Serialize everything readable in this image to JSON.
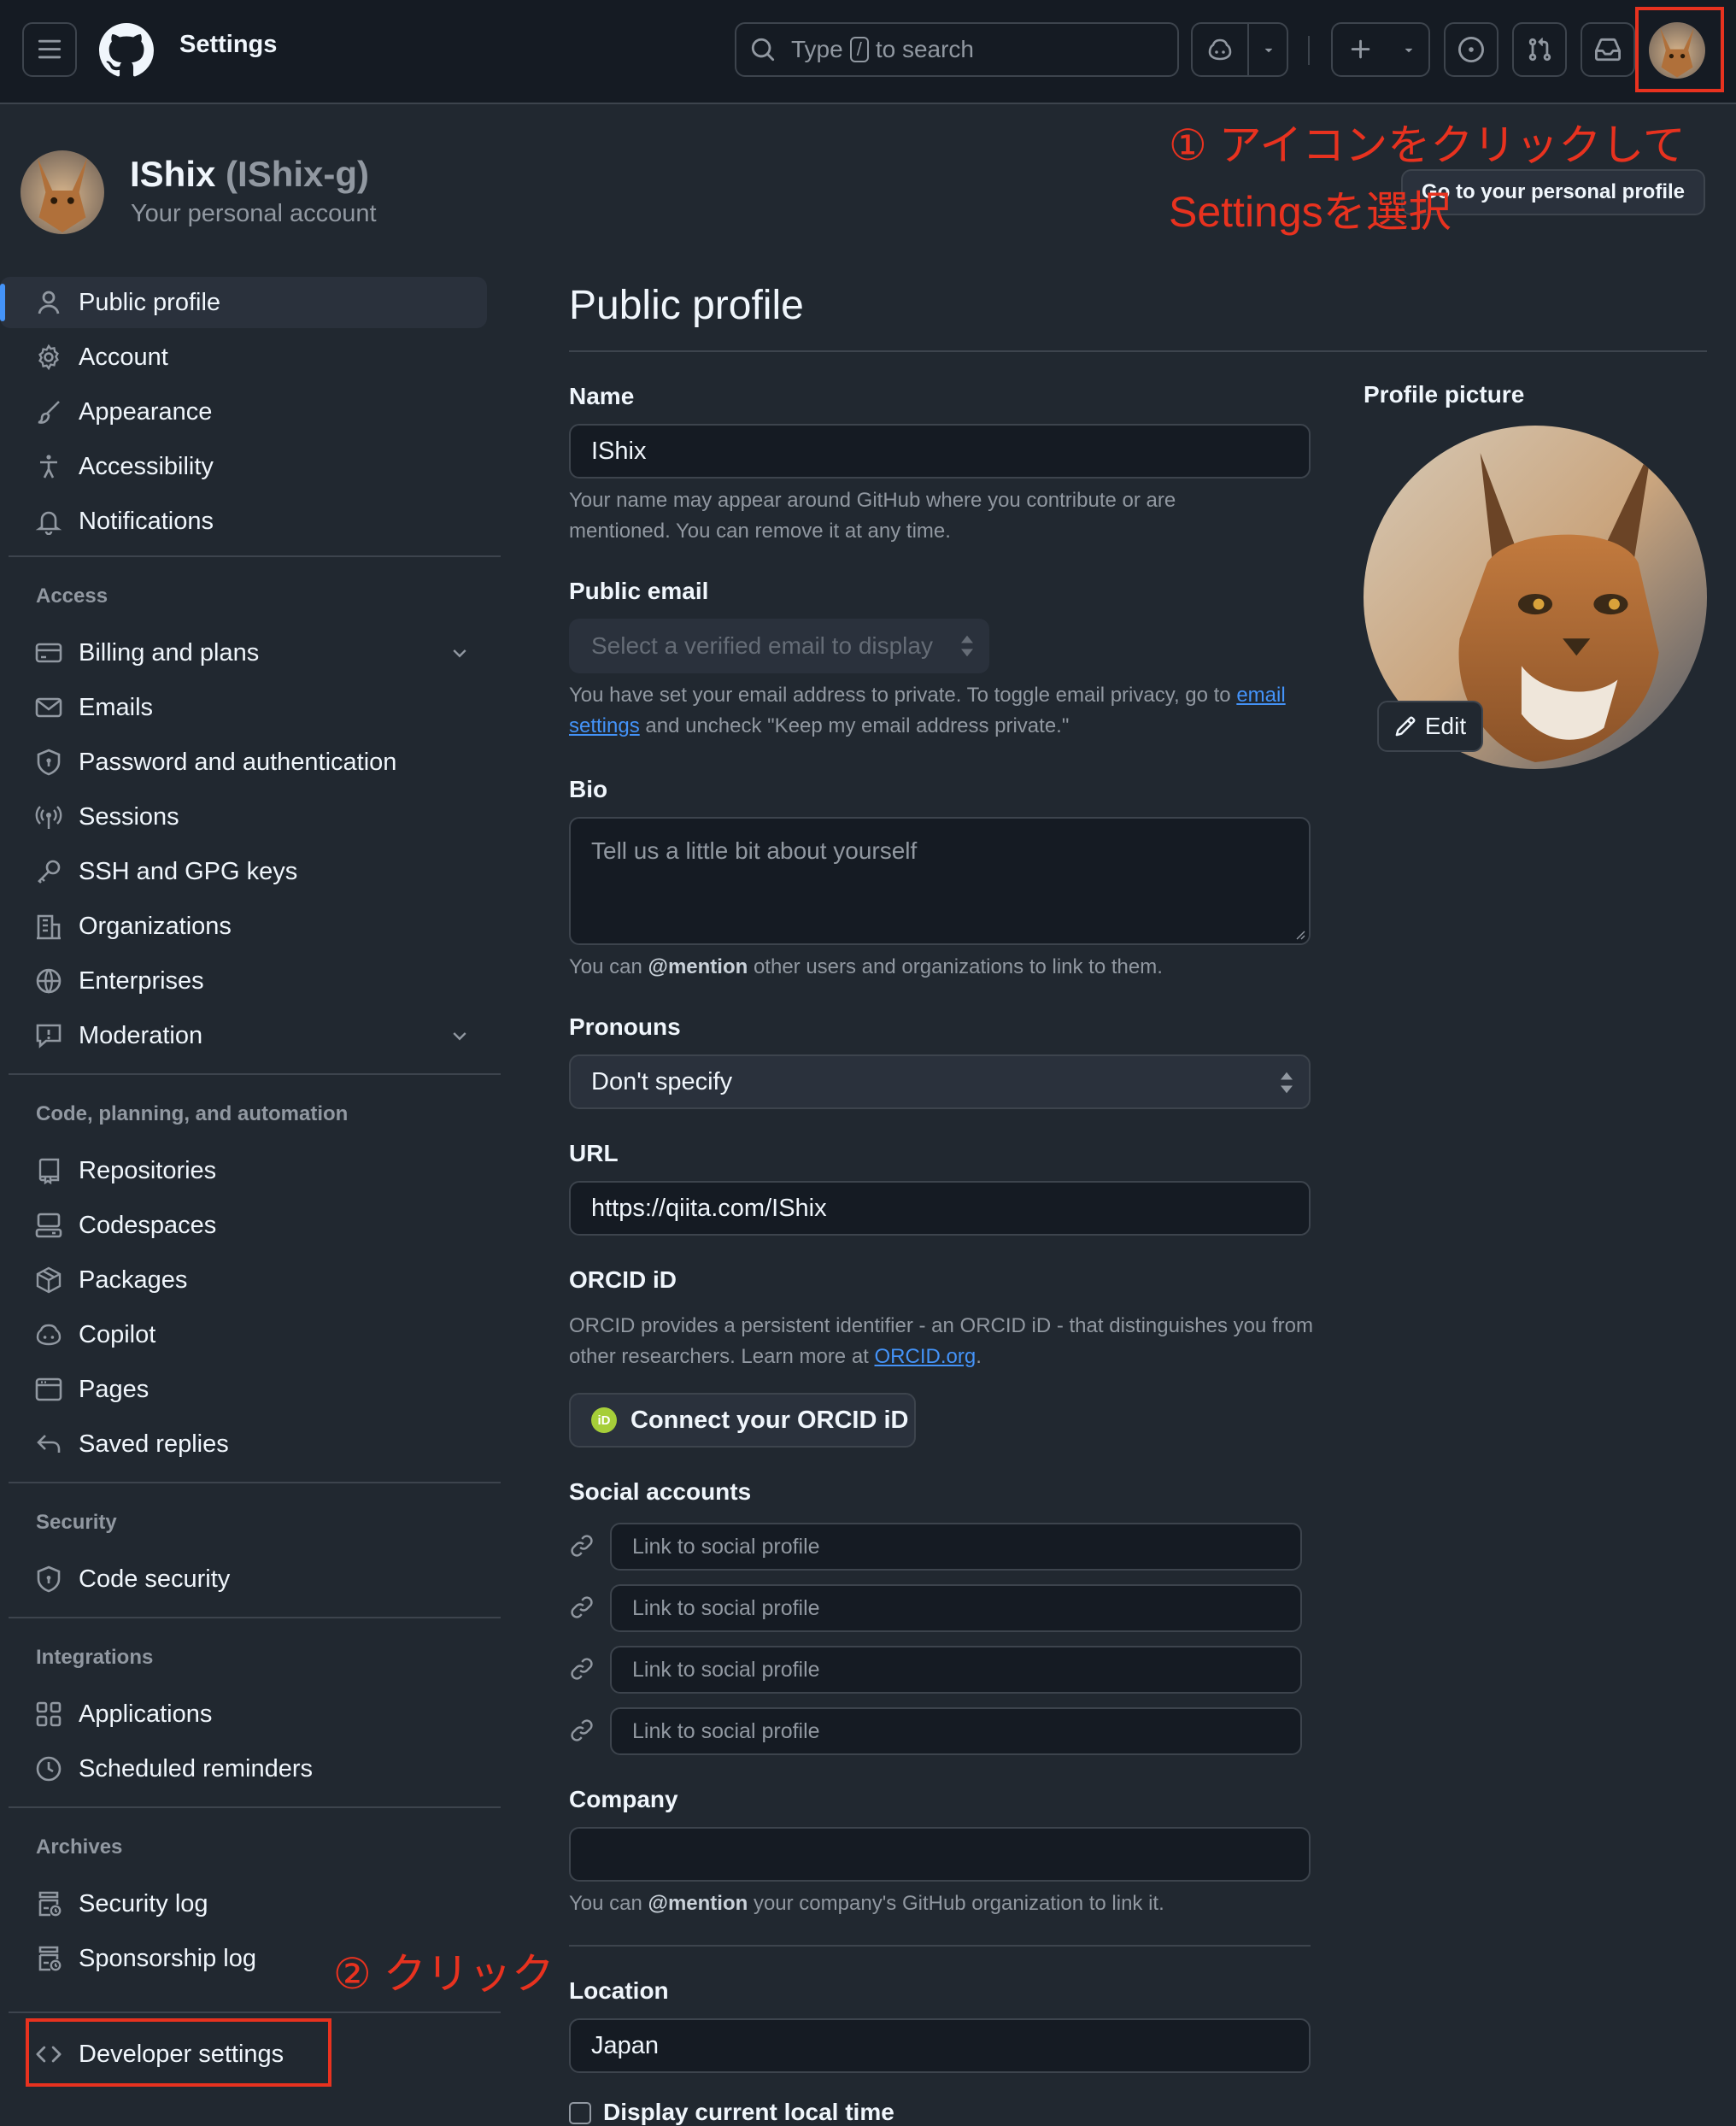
{
  "header": {
    "title": "Settings",
    "search_pre": "Type",
    "search_key": "/",
    "search_post": "to search"
  },
  "account": {
    "display_name": "IShix",
    "handle": "(IShix-g)",
    "subtitle": "Your personal account",
    "profile_button": "Go to your personal profile"
  },
  "sidebar": {
    "top_items": [
      {
        "label": "Public profile",
        "icon": "person-icon"
      },
      {
        "label": "Account",
        "icon": "gear-icon"
      },
      {
        "label": "Appearance",
        "icon": "paintbrush-icon"
      },
      {
        "label": "Accessibility",
        "icon": "accessibility-icon"
      },
      {
        "label": "Notifications",
        "icon": "bell-icon"
      }
    ],
    "sections": [
      {
        "heading": "Access",
        "items": [
          {
            "label": "Billing and plans",
            "icon": "credit-card-icon",
            "expandable": true
          },
          {
            "label": "Emails",
            "icon": "mail-icon"
          },
          {
            "label": "Password and authentication",
            "icon": "shield-lock-icon"
          },
          {
            "label": "Sessions",
            "icon": "broadcast-icon"
          },
          {
            "label": "SSH and GPG keys",
            "icon": "key-icon"
          },
          {
            "label": "Organizations",
            "icon": "organization-icon"
          },
          {
            "label": "Enterprises",
            "icon": "globe-icon"
          },
          {
            "label": "Moderation",
            "icon": "report-icon",
            "expandable": true
          }
        ]
      },
      {
        "heading": "Code, planning, and automation",
        "items": [
          {
            "label": "Repositories",
            "icon": "repo-icon"
          },
          {
            "label": "Codespaces",
            "icon": "codespaces-icon"
          },
          {
            "label": "Packages",
            "icon": "package-icon"
          },
          {
            "label": "Copilot",
            "icon": "copilot-icon"
          },
          {
            "label": "Pages",
            "icon": "browser-icon"
          },
          {
            "label": "Saved replies",
            "icon": "reply-icon"
          }
        ]
      },
      {
        "heading": "Security",
        "items": [
          {
            "label": "Code security",
            "icon": "shield-icon"
          }
        ]
      },
      {
        "heading": "Integrations",
        "items": [
          {
            "label": "Applications",
            "icon": "apps-icon"
          },
          {
            "label": "Scheduled reminders",
            "icon": "clock-icon"
          }
        ]
      },
      {
        "heading": "Archives",
        "items": [
          {
            "label": "Security log",
            "icon": "log-icon"
          },
          {
            "label": "Sponsorship log",
            "icon": "log-icon"
          }
        ]
      }
    ],
    "developer": {
      "label": "Developer settings",
      "icon": "code-icon"
    }
  },
  "main": {
    "heading": "Public profile",
    "name": {
      "label": "Name",
      "value": "IShix",
      "note": "Your name may appear around GitHub where you contribute or are mentioned. You can remove it at any time."
    },
    "public_email": {
      "label": "Public email",
      "placeholder": "Select a verified email to display",
      "note_pre": "You have set your email address to private. To toggle email privacy, go to",
      "note_link": "email settings",
      "note_post": "and uncheck \"Keep my email address private.\""
    },
    "bio": {
      "label": "Bio",
      "placeholder": "Tell us a little bit about yourself",
      "note_pre": "You can",
      "note_mention": "@mention",
      "note_post": "other users and organizations to link to them."
    },
    "pronouns": {
      "label": "Pronouns",
      "value": "Don't specify"
    },
    "url": {
      "label": "URL",
      "value": "https://qiita.com/IShix"
    },
    "orcid": {
      "label": "ORCID iD",
      "note_pre": "ORCID provides a persistent identifier - an ORCID iD - that distinguishes you from other researchers. Learn more at",
      "note_link": "ORCID.org",
      "note_post": ".",
      "button": "Connect your ORCID iD",
      "badge": "iD"
    },
    "social": {
      "label": "Social accounts",
      "placeholder": "Link to social profile"
    },
    "company": {
      "label": "Company",
      "value": "",
      "note_pre": "You can",
      "note_mention": "@mention",
      "note_post": "your company's GitHub organization to link it."
    },
    "location": {
      "label": "Location",
      "value": "Japan"
    },
    "local_time": {
      "label": "Display current local time"
    }
  },
  "profile_picture": {
    "label": "Profile picture",
    "edit": "Edit"
  },
  "annotations": {
    "step1_line1": "① アイコンをクリックして",
    "step1_line2": "Settingsを選択",
    "step2": "② クリック",
    "color": "#e8321f"
  }
}
